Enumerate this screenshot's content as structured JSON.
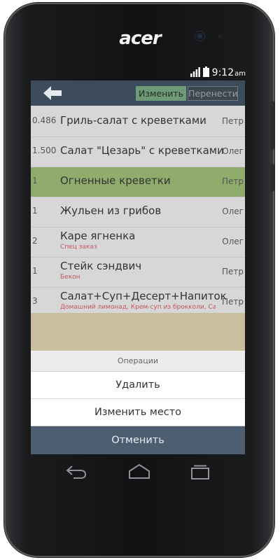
{
  "device": {
    "brand": "acer"
  },
  "status_bar": {
    "time": "9:12",
    "ampm": "am"
  },
  "toolbar": {
    "edit_label": "Изменить",
    "move_label": "Перенести"
  },
  "orders": [
    {
      "qty": "0.486",
      "name": "Гриль-салат с креветками",
      "note": "",
      "waiter": "Петр",
      "selected": false
    },
    {
      "qty": "1.500",
      "name": "Салат \"Цезарь\" с креветками",
      "note": "",
      "waiter": "Олег",
      "selected": false
    },
    {
      "qty": "1",
      "name": "Огненные креветки",
      "note": "",
      "waiter": "Петр",
      "selected": true
    },
    {
      "qty": "1",
      "name": "Жульен из грибов",
      "note": "",
      "waiter": "Олег",
      "selected": false
    },
    {
      "qty": "2",
      "name": "Каре ягненка",
      "note": "Спец заказ",
      "waiter": "Олег",
      "selected": false
    },
    {
      "qty": "1",
      "name": "Стейк сэндвич",
      "note": "Бекон",
      "waiter": "Петр",
      "selected": false
    },
    {
      "qty": "3",
      "name": "Салат+Суп+Десерт+Напиток",
      "note": "Домашний лимонад, Крем-суп из брокколи, Са…",
      "waiter": "Петр",
      "selected": false
    }
  ],
  "action_sheet": {
    "title": "Операции",
    "delete_label": "Удалить",
    "change_place_label": "Изменить место",
    "cancel_label": "Отменить"
  }
}
